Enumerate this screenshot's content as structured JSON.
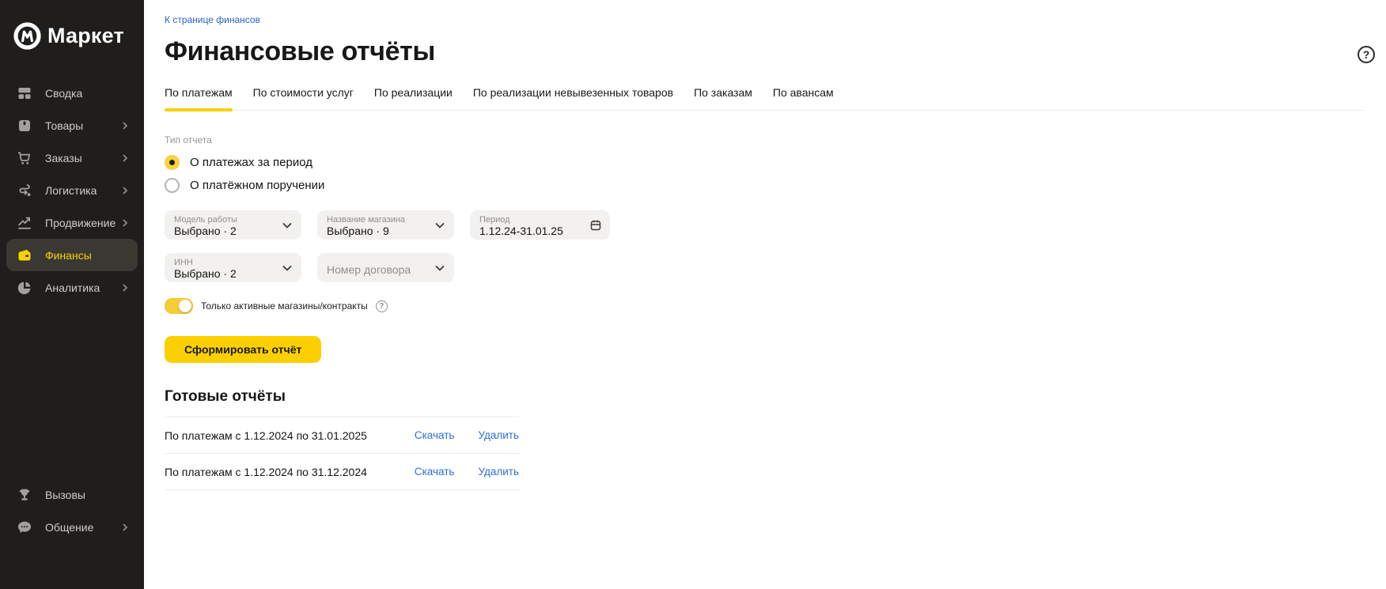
{
  "sidebar": {
    "logo_text": "Маркет",
    "items": [
      {
        "label": "Сводка",
        "icon": "dashboard-icon",
        "chevron": false,
        "active": false
      },
      {
        "label": "Товары",
        "icon": "package-icon",
        "chevron": true,
        "active": false
      },
      {
        "label": "Заказы",
        "icon": "cart-icon",
        "chevron": true,
        "active": false
      },
      {
        "label": "Логистика",
        "icon": "route-icon",
        "chevron": true,
        "active": false
      },
      {
        "label": "Продвижение",
        "icon": "trending-icon",
        "chevron": true,
        "active": false
      },
      {
        "label": "Финансы",
        "icon": "wallet-icon",
        "chevron": false,
        "active": true
      },
      {
        "label": "Аналитика",
        "icon": "pie-chart-icon",
        "chevron": true,
        "active": false
      }
    ],
    "bottom_items": [
      {
        "label": "Вызовы",
        "icon": "trophy-icon",
        "chevron": false
      },
      {
        "label": "Общение",
        "icon": "chat-icon",
        "chevron": true
      }
    ]
  },
  "header": {
    "back_link": "К странице финансов",
    "title": "Финансовые отчёты",
    "help_icon": "question-icon"
  },
  "tabs": [
    {
      "label": "По платежам",
      "active": true
    },
    {
      "label": "По стоимости услуг",
      "active": false
    },
    {
      "label": "По реализации",
      "active": false
    },
    {
      "label": "По реализации невывезенных товаров",
      "active": false
    },
    {
      "label": "По заказам",
      "active": false
    },
    {
      "label": "По авансам",
      "active": false
    }
  ],
  "report_type": {
    "label": "Тип отчета",
    "options": [
      {
        "label": "О платежах за период",
        "selected": true
      },
      {
        "label": "О платёжном поручении",
        "selected": false
      }
    ]
  },
  "filters": {
    "work_model": {
      "label": "Модель работы",
      "value": "Выбрано · 2"
    },
    "shop_name": {
      "label": "Название магазина",
      "value": "Выбрано · 9"
    },
    "period": {
      "label": "Период",
      "value": "1.12.24-31.01.25",
      "icon": "calendar-icon"
    },
    "inn": {
      "label": "ИНН",
      "value": "Выбрано · 2"
    },
    "contract_number": {
      "placeholder": "Номер договора"
    },
    "active_only": {
      "label": "Только активные магазины/контракты",
      "enabled": true
    }
  },
  "actions": {
    "generate_button": "Сформировать отчёт"
  },
  "ready_reports": {
    "heading": "Готовые отчёты",
    "download_label": "Скачать",
    "delete_label": "Удалить",
    "rows": [
      {
        "title": "По платежам с 1.12.2024 по 31.01.2025"
      },
      {
        "title": "По платежам с 1.12.2024 по 31.12.2024"
      }
    ]
  },
  "colors": {
    "accent_yellow": "#fcd000",
    "link_blue": "#2f6fd8",
    "sidebar_bg": "#201e1d",
    "sidebar_active_bg": "#3a3833",
    "field_bg": "#f2f1ef"
  }
}
